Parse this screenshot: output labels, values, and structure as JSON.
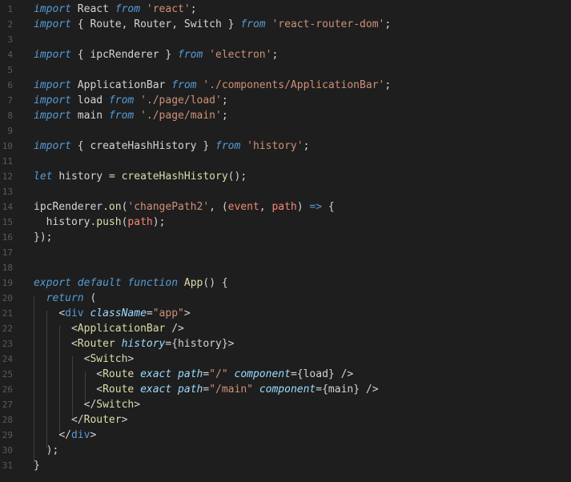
{
  "editor": {
    "language": "javascript-jsx",
    "colors": {
      "background": "#1e1e1e",
      "keyword": "#569cd6",
      "string": "#ce9178",
      "function": "#dcdcaa",
      "variable": "#9cdcfe",
      "line_number": "#5a5a5a"
    },
    "lines": [
      {
        "num": "1",
        "text": "import React from 'react';"
      },
      {
        "num": "2",
        "text": "import { Route, Router, Switch } from 'react-router-dom';"
      },
      {
        "num": "3",
        "text": ""
      },
      {
        "num": "4",
        "text": "import { ipcRenderer } from 'electron';"
      },
      {
        "num": "5",
        "text": ""
      },
      {
        "num": "6",
        "text": "import ApplicationBar from './components/ApplicationBar';"
      },
      {
        "num": "7",
        "text": "import load from './page/load';"
      },
      {
        "num": "8",
        "text": "import main from './page/main';"
      },
      {
        "num": "9",
        "text": ""
      },
      {
        "num": "10",
        "text": "import { createHashHistory } from 'history';"
      },
      {
        "num": "11",
        "text": ""
      },
      {
        "num": "12",
        "text": "let history = createHashHistory();"
      },
      {
        "num": "13",
        "text": ""
      },
      {
        "num": "14",
        "text": "ipcRenderer.on('changePath2', (event, path) => {"
      },
      {
        "num": "15",
        "text": "  history.push(path);"
      },
      {
        "num": "16",
        "text": "});"
      },
      {
        "num": "17",
        "text": ""
      },
      {
        "num": "18",
        "text": ""
      },
      {
        "num": "19",
        "text": "export default function App() {"
      },
      {
        "num": "20",
        "text": "  return ("
      },
      {
        "num": "21",
        "text": "    <div className=\"app\">"
      },
      {
        "num": "22",
        "text": "      <ApplicationBar />"
      },
      {
        "num": "23",
        "text": "      <Router history={history}>"
      },
      {
        "num": "24",
        "text": "        <Switch>"
      },
      {
        "num": "25",
        "text": "          <Route exact path=\"/\" component={load} />"
      },
      {
        "num": "26",
        "text": "          <Route exact path=\"/main\" component={main} />"
      },
      {
        "num": "27",
        "text": "        </Switch>"
      },
      {
        "num": "28",
        "text": "      </Router>"
      },
      {
        "num": "29",
        "text": "    </div>"
      },
      {
        "num": "30",
        "text": "  );"
      },
      {
        "num": "31",
        "text": "}"
      }
    ]
  }
}
